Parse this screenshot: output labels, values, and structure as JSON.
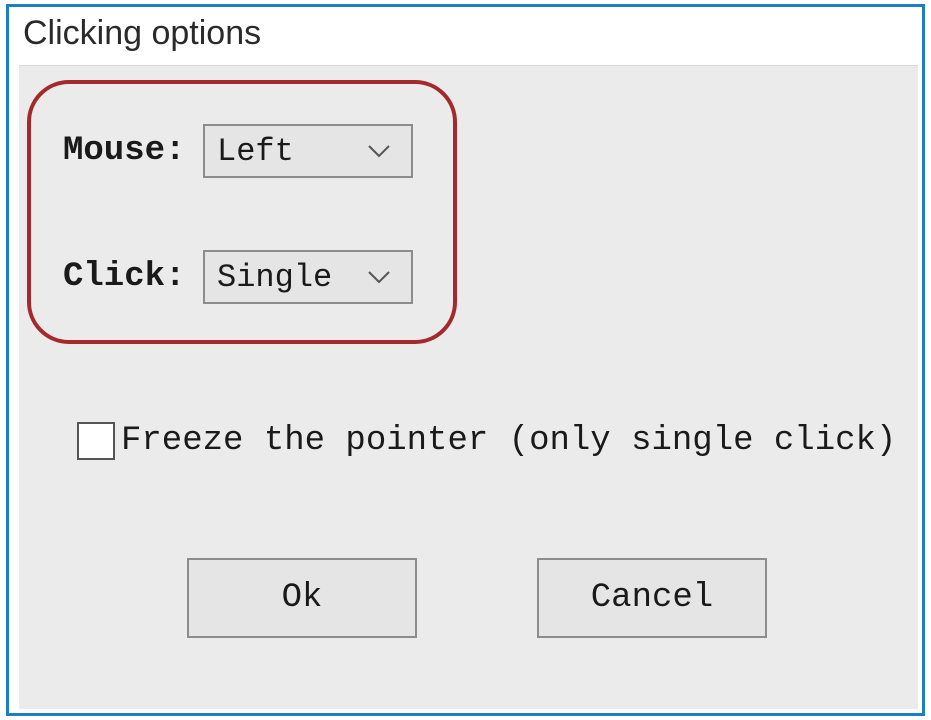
{
  "window": {
    "title": "Clicking options"
  },
  "fields": {
    "mouse": {
      "label": "Mouse:",
      "value": "Left"
    },
    "click": {
      "label": "Click:",
      "value": "Single"
    }
  },
  "checkbox": {
    "label": "Freeze the pointer (only single click)",
    "checked": false
  },
  "buttons": {
    "ok": "Ok",
    "cancel": "Cancel"
  }
}
